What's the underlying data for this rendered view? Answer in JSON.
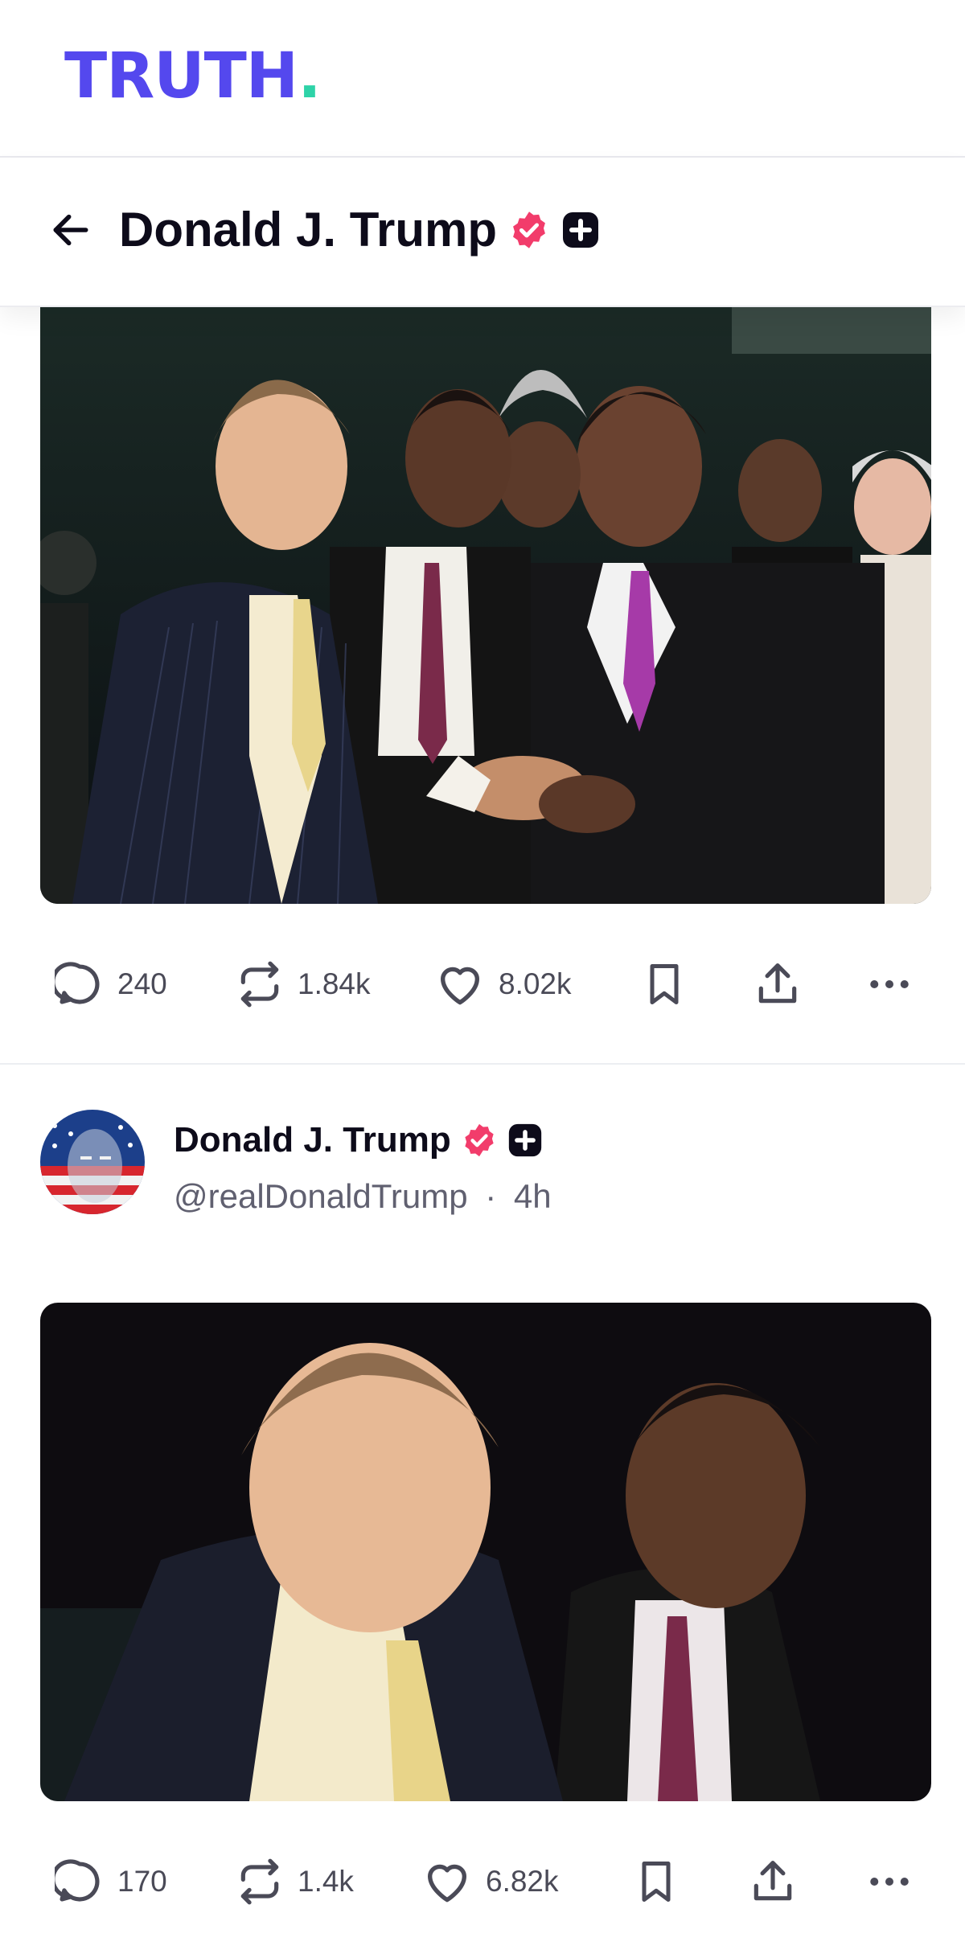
{
  "app": {
    "logo_text": "TRUTH",
    "logo_dot": ".",
    "brand_color": "#5448ee",
    "accent_color": "#2ed3a8"
  },
  "header": {
    "title": "Donald J. Trump",
    "verified_color": "#f23c6b"
  },
  "posts": [
    {
      "image_alt": "Photo of a group of men in suits at a boxing event",
      "actions": {
        "replies": "240",
        "retruths": "1.84k",
        "likes": "8.02k"
      }
    },
    {
      "author": {
        "name": "Donald J. Trump",
        "handle": "@realDonaldTrump",
        "separator": "·",
        "time": "4h"
      },
      "image_alt": "Close-up photo of two men in suits",
      "actions": {
        "replies": "170",
        "retruths": "1.4k",
        "likes": "6.82k"
      }
    }
  ],
  "icons": [
    "back-arrow-icon",
    "verified-icon",
    "plus-badge-icon",
    "reply-icon",
    "retruth-icon",
    "like-icon",
    "bookmark-icon",
    "share-icon",
    "more-icon"
  ]
}
